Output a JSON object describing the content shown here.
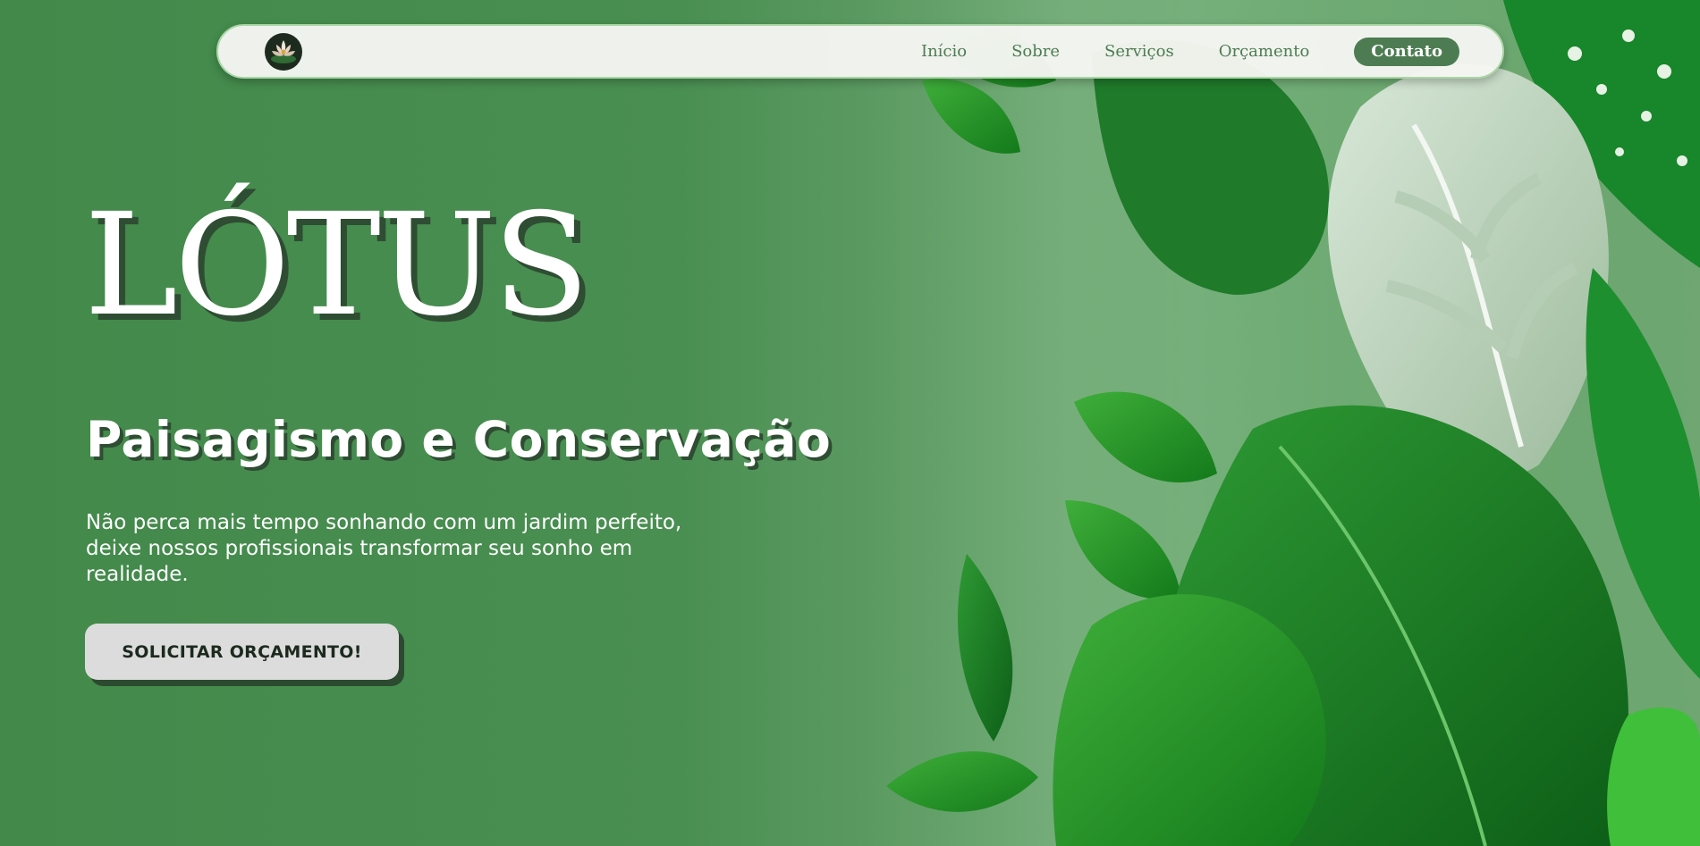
{
  "nav": {
    "logo_alt": "Lótus logo",
    "links": [
      {
        "label": "Início"
      },
      {
        "label": "Sobre"
      },
      {
        "label": "Serviços"
      },
      {
        "label": "Orçamento"
      }
    ],
    "contact_label": "Contato"
  },
  "hero": {
    "title": "LÓTUS",
    "subtitle": "Paisagismo e Conservação",
    "description": "Não perca mais tempo sonhando com um jardim perfeito, deixe nossos profissionais transformar seu sonho em realidade.",
    "cta_label": "SOLICITAR ORÇAMENTO!"
  },
  "colors": {
    "background_green": "#4a8f52",
    "nav_bg": "#f6f6f2",
    "nav_text": "#4d7c52",
    "contact_button_bg": "#4d7c52",
    "cta_bg": "#dcdcdc",
    "text_shadow": "#2e4d33"
  },
  "icons": {
    "logo": "lotus-flower-icon",
    "background": "tropical-leaves-illustration"
  }
}
